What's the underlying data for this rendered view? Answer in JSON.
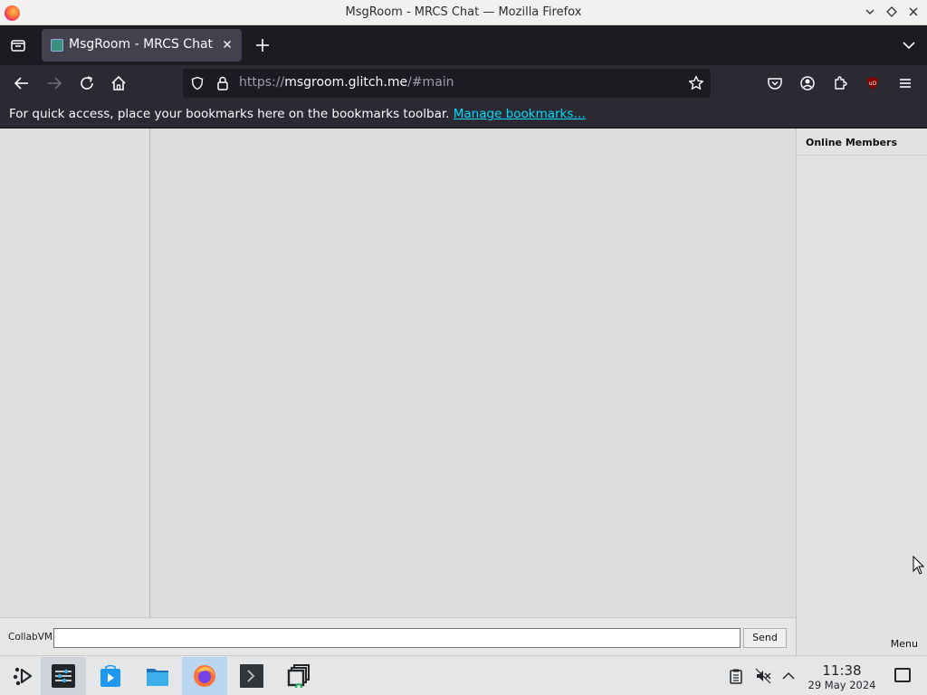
{
  "window": {
    "title": "MsgRoom - MRCS Chat — Mozilla Firefox"
  },
  "tabs": [
    {
      "label": "MsgRoom - MRCS Chat",
      "active": true
    }
  ],
  "urlbar": {
    "scheme": "https://",
    "host": "msgroom.glitch.me",
    "path": "/#main"
  },
  "bookmarks_bar": {
    "message": "For quick access, place your bookmarks here on the bookmarks toolbar.",
    "link_label": "Manage bookmarks…"
  },
  "chat": {
    "members_header": "Online Members",
    "menu_label": "Menu",
    "nickname": "CollabVM",
    "message_value": "",
    "send_label": "Send"
  },
  "taskbar": {
    "apps": [
      "app-launcher",
      "system-settings",
      "discover-store",
      "file-manager",
      "firefox",
      "terminal",
      "task-switcher"
    ],
    "active_app": "firefox",
    "clock_time": "11:38",
    "clock_date": "29 May 2024"
  },
  "colors": {
    "link": "#00ddff",
    "toolbar_bg": "#2b2a33",
    "page_bg": "#dcdcdc",
    "taskbar_active": "#b9d5ef"
  }
}
